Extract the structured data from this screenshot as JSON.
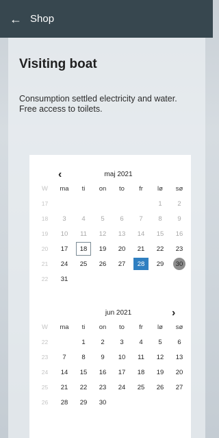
{
  "topbar": {
    "back_icon": "arrow-left-icon",
    "title": "Shop",
    "color": "#37474f"
  },
  "page": {
    "heading": "Visiting boat",
    "description_line1": "Consumption settled electricity and water.",
    "description_line2": "Free access to toilets."
  },
  "calendar": {
    "selected_color": "#2f7fc1",
    "weekday_headers": [
      "W",
      "ma",
      "ti",
      "on",
      "to",
      "fr",
      "lø",
      "sø"
    ],
    "months": [
      {
        "title": "maj 2021",
        "nav": "prev",
        "weeks": [
          {
            "week": "17",
            "days": [
              "",
              "",
              "",
              "",
              "",
              "1",
              "2"
            ]
          },
          {
            "week": "18",
            "days": [
              "3",
              "4",
              "5",
              "6",
              "7",
              "8",
              "9"
            ]
          },
          {
            "week": "19",
            "days": [
              "10",
              "11",
              "12",
              "13",
              "14",
              "15",
              "16"
            ]
          },
          {
            "week": "20",
            "days": [
              "17",
              "18",
              "19",
              "20",
              "21",
              "22",
              "23"
            ]
          },
          {
            "week": "21",
            "days": [
              "24",
              "25",
              "26",
              "27",
              "28",
              "29",
              "30"
            ]
          },
          {
            "week": "22",
            "days": [
              "31",
              "",
              "",
              "",
              "",
              "",
              ""
            ]
          }
        ],
        "past_before_day": 17,
        "today": "18",
        "selected": "28",
        "hovered": "30"
      },
      {
        "title": "jun 2021",
        "nav": "next",
        "weeks": [
          {
            "week": "22",
            "days": [
              "",
              "1",
              "2",
              "3",
              "4",
              "5",
              "6"
            ]
          },
          {
            "week": "23",
            "days": [
              "7",
              "8",
              "9",
              "10",
              "11",
              "12",
              "13"
            ]
          },
          {
            "week": "24",
            "days": [
              "14",
              "15",
              "16",
              "17",
              "18",
              "19",
              "20"
            ]
          },
          {
            "week": "25",
            "days": [
              "21",
              "22",
              "23",
              "24",
              "25",
              "26",
              "27"
            ]
          },
          {
            "week": "26",
            "days": [
              "28",
              "29",
              "30",
              "",
              "",
              "",
              ""
            ]
          }
        ],
        "past_before_day": 0,
        "today": "",
        "selected": "",
        "hovered": ""
      }
    ]
  }
}
